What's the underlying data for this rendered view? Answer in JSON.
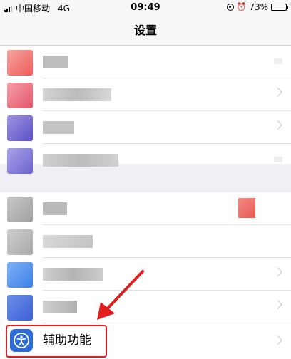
{
  "status_bar": {
    "carrier": "中国移动",
    "network": "4G",
    "time": "09:49",
    "battery": "73%",
    "battery_level": 0.73
  },
  "nav": {
    "title": "设置"
  },
  "groups": [
    {
      "rows": [
        {
          "blurred": true
        },
        {
          "blurred": true
        },
        {
          "blurred": true
        },
        {
          "blurred": true
        }
      ]
    },
    {
      "rows": [
        {
          "blurred": true,
          "badge": true
        },
        {
          "blurred": true
        },
        {
          "blurred": true
        },
        {
          "blurred": true
        }
      ]
    }
  ],
  "accessibility": {
    "label": "辅助功能",
    "icon": "accessibility-icon",
    "icon_color": "#2d6bd6"
  },
  "annotation": {
    "highlight_color": "#e01e1e"
  }
}
